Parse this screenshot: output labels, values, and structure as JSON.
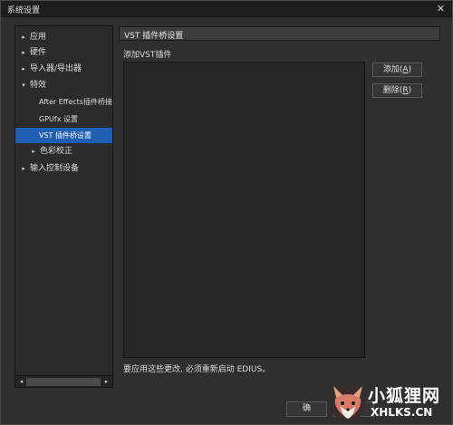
{
  "window": {
    "title": "系统设置",
    "close_glyph": "✕"
  },
  "tree": {
    "items": [
      {
        "label": "应用",
        "arrow": "▸"
      },
      {
        "label": "硬件",
        "arrow": "▸"
      },
      {
        "label": "导入器/导出器",
        "arrow": "▸"
      },
      {
        "label": "特效",
        "arrow": "▾"
      },
      {
        "label": "After Effects插件桥接",
        "arrow": ""
      },
      {
        "label": "GPUfx 设置",
        "arrow": ""
      },
      {
        "label": "VST 插件桥设置",
        "arrow": ""
      },
      {
        "label": "色彩校正",
        "arrow": "▸"
      },
      {
        "label": "输入控制设备",
        "arrow": "▸"
      }
    ],
    "selected": "VST 插件桥设置",
    "scroll_left_glyph": "◂",
    "scroll_right_glyph": "▸"
  },
  "panel": {
    "header": "VST 插件桥设置",
    "section_label": "添加VST插件",
    "add_button": {
      "label": "添加",
      "shortcut": "A"
    },
    "remove_button": {
      "label": "删除",
      "shortcut": "R"
    },
    "notice": "要应用这些更改, 必须重新启动 EDIUS。"
  },
  "footer": {
    "ok_label": "确"
  },
  "watermark": {
    "cn": "小狐狸网",
    "en": "XHLKS.CN"
  }
}
